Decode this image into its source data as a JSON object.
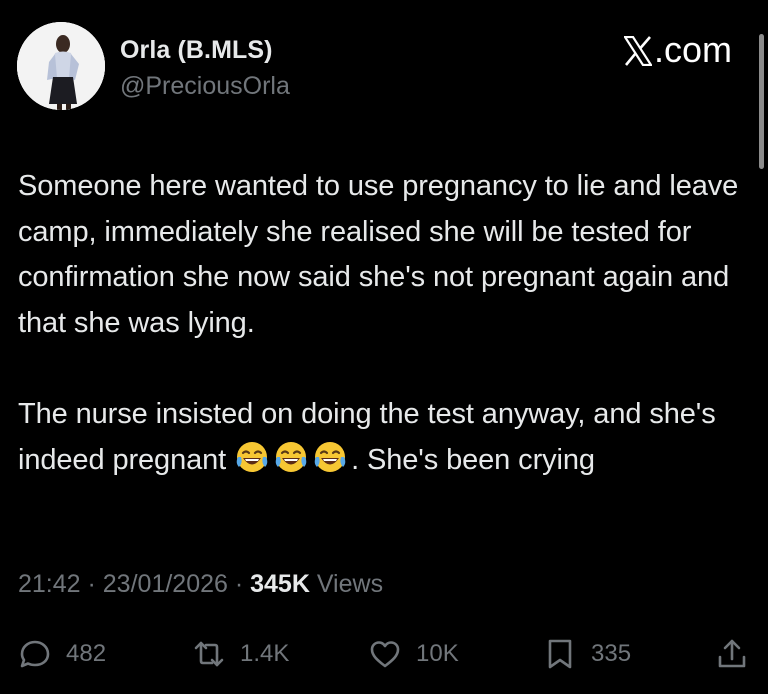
{
  "user": {
    "display_name": "Orla (B.MLS)",
    "handle": "@PreciousOrla",
    "avatar_icon": "profile-photo"
  },
  "brand": {
    "label": ".com",
    "icon": "x-logo-icon"
  },
  "tweet": {
    "paragraph1": "Someone here wanted to use pregnancy to lie and leave camp, immediately she realised she will be tested for confirmation she now said she's not pregnant again and that she was lying.",
    "paragraph2_before_emoji": "The nurse insisted on doing the test anyway, and she's indeed pregnant ",
    "emoji": [
      "face-with-tears-of-joy",
      "face-with-tears-of-joy",
      "face-with-tears-of-joy"
    ],
    "paragraph2_after_emoji": ". She's been crying"
  },
  "meta": {
    "time": "21:42",
    "separator1": " · ",
    "date": "23/01/2026",
    "separator2": " · ",
    "views_count": "345K",
    "views_label": " Views"
  },
  "actions": {
    "replies": "482",
    "reposts": "1.4K",
    "likes": "10K",
    "bookmarks": "335"
  },
  "colors": {
    "background": "#000000",
    "primary_text": "#e7e9ea",
    "secondary_text": "#71767b"
  }
}
